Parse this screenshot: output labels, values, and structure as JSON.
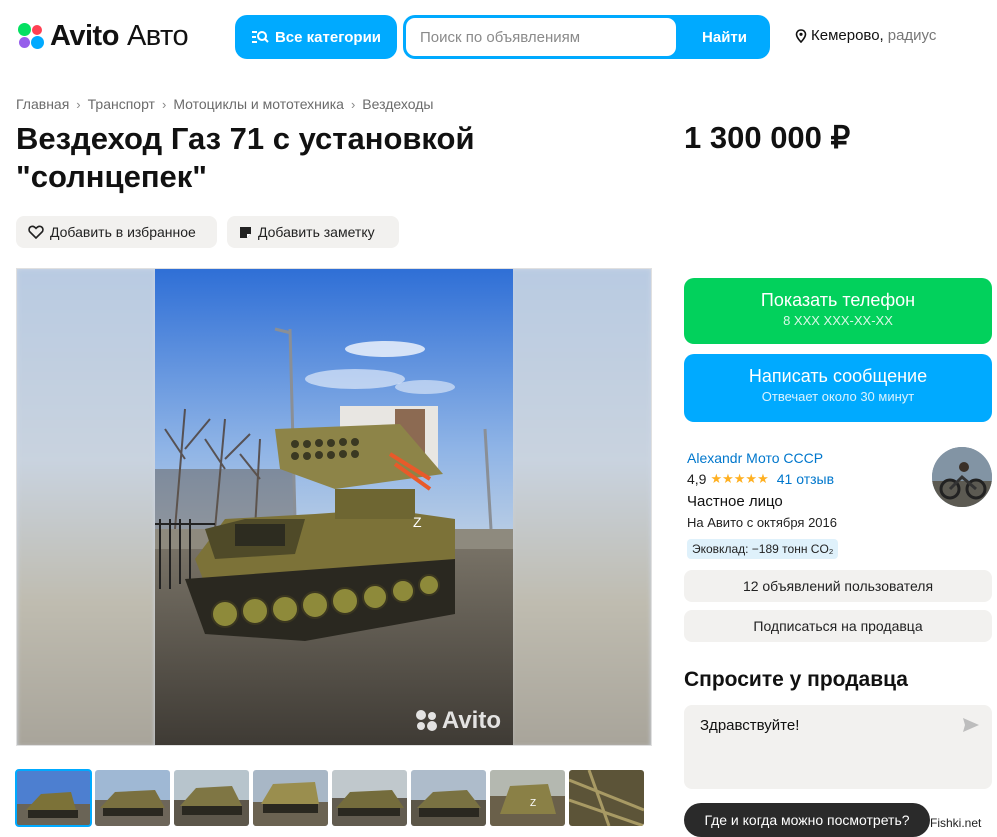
{
  "header": {
    "logo_main": "Avito",
    "logo_sub": "Авто",
    "categories_label": "Все категории",
    "search_placeholder": "Поиск по объявлениям",
    "search_button": "Найти",
    "location_city": "Кемерово,",
    "location_radius": "радиус"
  },
  "breadcrumbs": [
    "Главная",
    "Транспорт",
    "Мотоциклы и мототехника",
    "Вездеходы"
  ],
  "listing": {
    "title": "Вездеход Газ 71 с установкой \"солнцепек\"",
    "price": "1 300 000 ₽",
    "favorite_label": "Добавить в избранное",
    "note_label": "Добавить заметку",
    "watermark": "Avito",
    "thumbnail_count": 8
  },
  "contact": {
    "phone_label": "Показать телефон",
    "phone_masked": "8 XXX XXX-XX-XX",
    "message_label": "Написать сообщение",
    "message_sub": "Отвечает около 30 минут"
  },
  "seller": {
    "name": "Alexandr Мото СССР",
    "rating": "4,9",
    "stars": 5,
    "reviews": "41 отзыв",
    "type": "Частное лицо",
    "since": "На Авито с октября 2016",
    "eco": "Эковклад: −189 тонн CO₂",
    "ads_button": "12 объявлений пользователя",
    "subscribe_button": "Подписаться на продавца"
  },
  "ask": {
    "title": "Спросите у продавца",
    "message": "Здравствуйте!",
    "suggestion": "Где и когда можно посмотреть?"
  },
  "footer_mark": "Fishki.net",
  "colors": {
    "brand_blue": "#00aaff",
    "green": "#02d15c",
    "link_blue": "#0077cc"
  }
}
